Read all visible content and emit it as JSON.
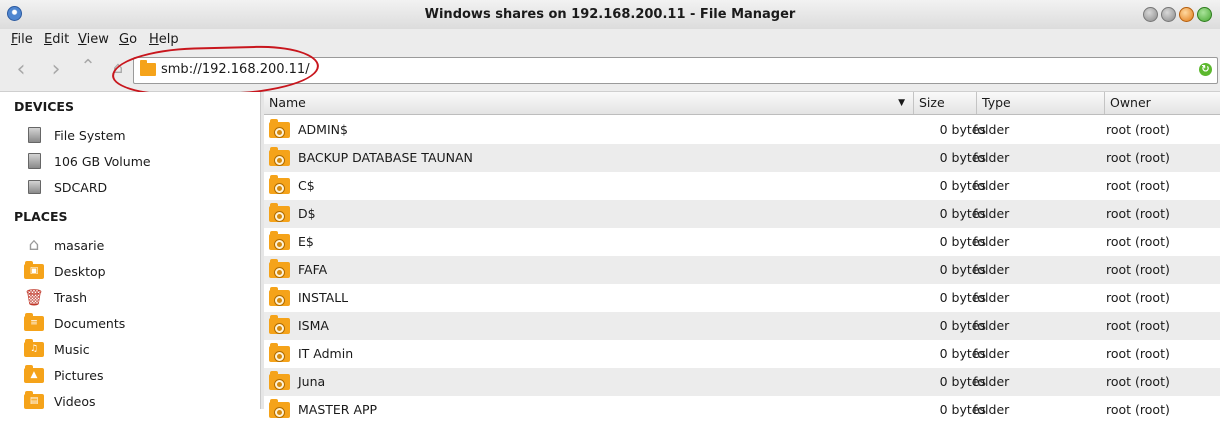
{
  "window": {
    "title": "Windows shares on 192.168.200.11 - File Manager"
  },
  "menu": [
    "File",
    "Edit",
    "View",
    "Go",
    "Help"
  ],
  "address": {
    "path": "smb://192.168.200.11/"
  },
  "sidebar": {
    "devices_label": "DEVICES",
    "devices": [
      "File System",
      "106 GB Volume",
      "SDCARD"
    ],
    "places_label": "PLACES",
    "places": [
      "masarie",
      "Desktop",
      "Trash",
      "Documents",
      "Music",
      "Pictures",
      "Videos"
    ]
  },
  "columns": {
    "name": "Name",
    "size": "Size",
    "type": "Type",
    "owner": "Owner"
  },
  "rows": [
    {
      "name": "ADMIN$",
      "size": "0 bytes",
      "type": "folder",
      "owner": "root (root)"
    },
    {
      "name": "BACKUP DATABASE TAUNAN",
      "size": "0 bytes",
      "type": "folder",
      "owner": "root (root)"
    },
    {
      "name": "C$",
      "size": "0 bytes",
      "type": "folder",
      "owner": "root (root)"
    },
    {
      "name": "D$",
      "size": "0 bytes",
      "type": "folder",
      "owner": "root (root)"
    },
    {
      "name": "E$",
      "size": "0 bytes",
      "type": "folder",
      "owner": "root (root)"
    },
    {
      "name": "FAFA",
      "size": "0 bytes",
      "type": "folder",
      "owner": "root (root)"
    },
    {
      "name": "INSTALL",
      "size": "0 bytes",
      "type": "folder",
      "owner": "root (root)"
    },
    {
      "name": "ISMA",
      "size": "0 bytes",
      "type": "folder",
      "owner": "root (root)"
    },
    {
      "name": "IT Admin",
      "size": "0 bytes",
      "type": "folder",
      "owner": "root (root)"
    },
    {
      "name": "Juna",
      "size": "0 bytes",
      "type": "folder",
      "owner": "root (root)"
    },
    {
      "name": "MASTER APP",
      "size": "0 bytes",
      "type": "folder",
      "owner": "root (root)"
    }
  ],
  "colors": {
    "folder": "#f5a31a",
    "annotation": "#c8161d",
    "alt_row": "#ececec"
  }
}
